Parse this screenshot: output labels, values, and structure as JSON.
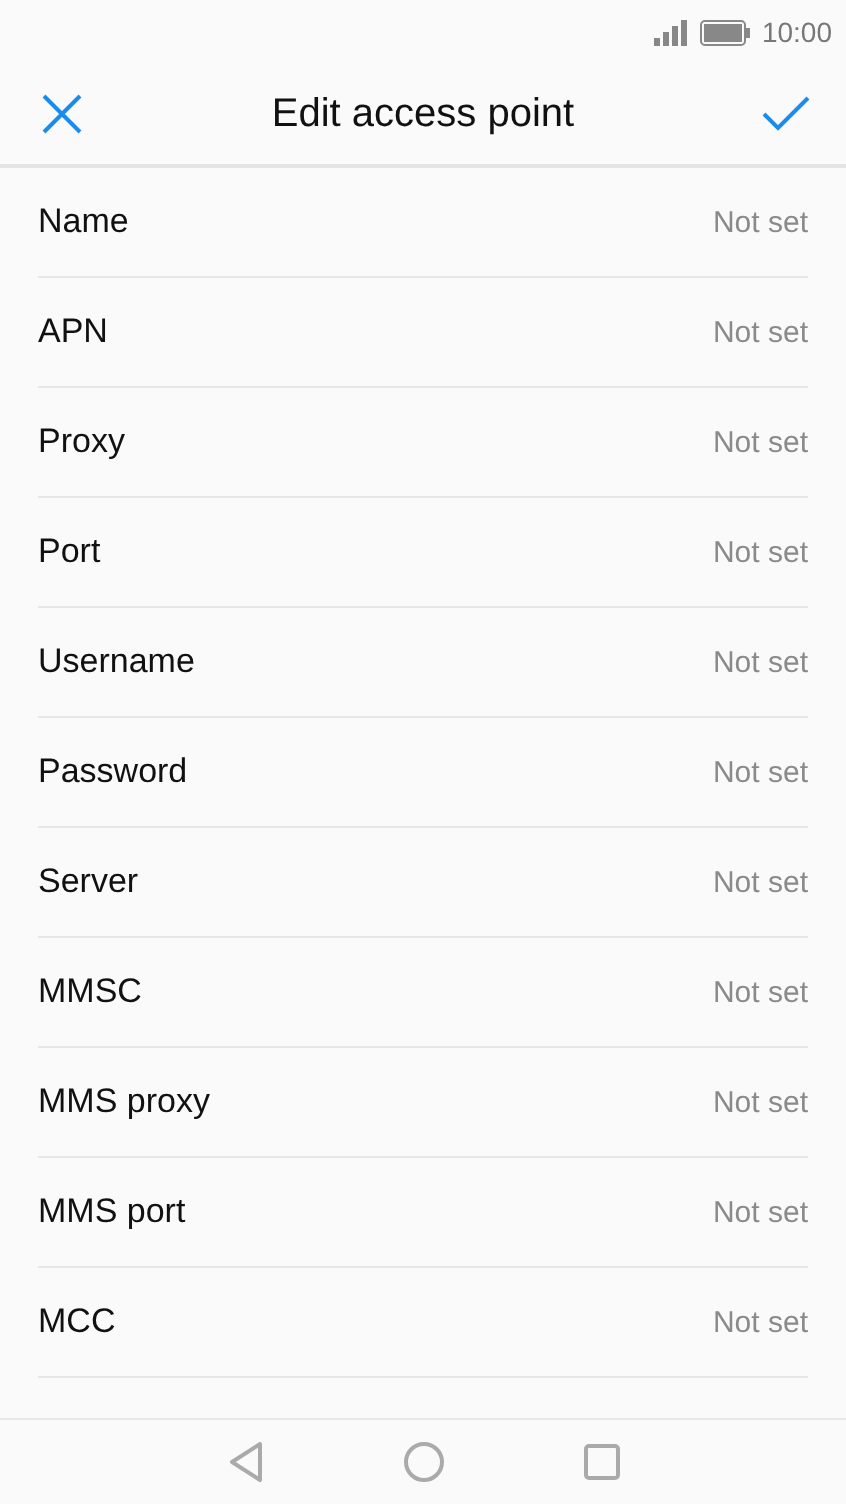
{
  "status_bar": {
    "time": "10:00"
  },
  "header": {
    "title": "Edit access point"
  },
  "settings": [
    {
      "label": "Name",
      "value": "Not set"
    },
    {
      "label": "APN",
      "value": "Not set"
    },
    {
      "label": "Proxy",
      "value": "Not set"
    },
    {
      "label": "Port",
      "value": "Not set"
    },
    {
      "label": "Username",
      "value": "Not set"
    },
    {
      "label": "Password",
      "value": "Not set"
    },
    {
      "label": "Server",
      "value": "Not set"
    },
    {
      "label": "MMSC",
      "value": "Not set"
    },
    {
      "label": "MMS proxy",
      "value": "Not set"
    },
    {
      "label": "MMS port",
      "value": "Not set"
    },
    {
      "label": "MCC",
      "value": "Not set"
    }
  ]
}
